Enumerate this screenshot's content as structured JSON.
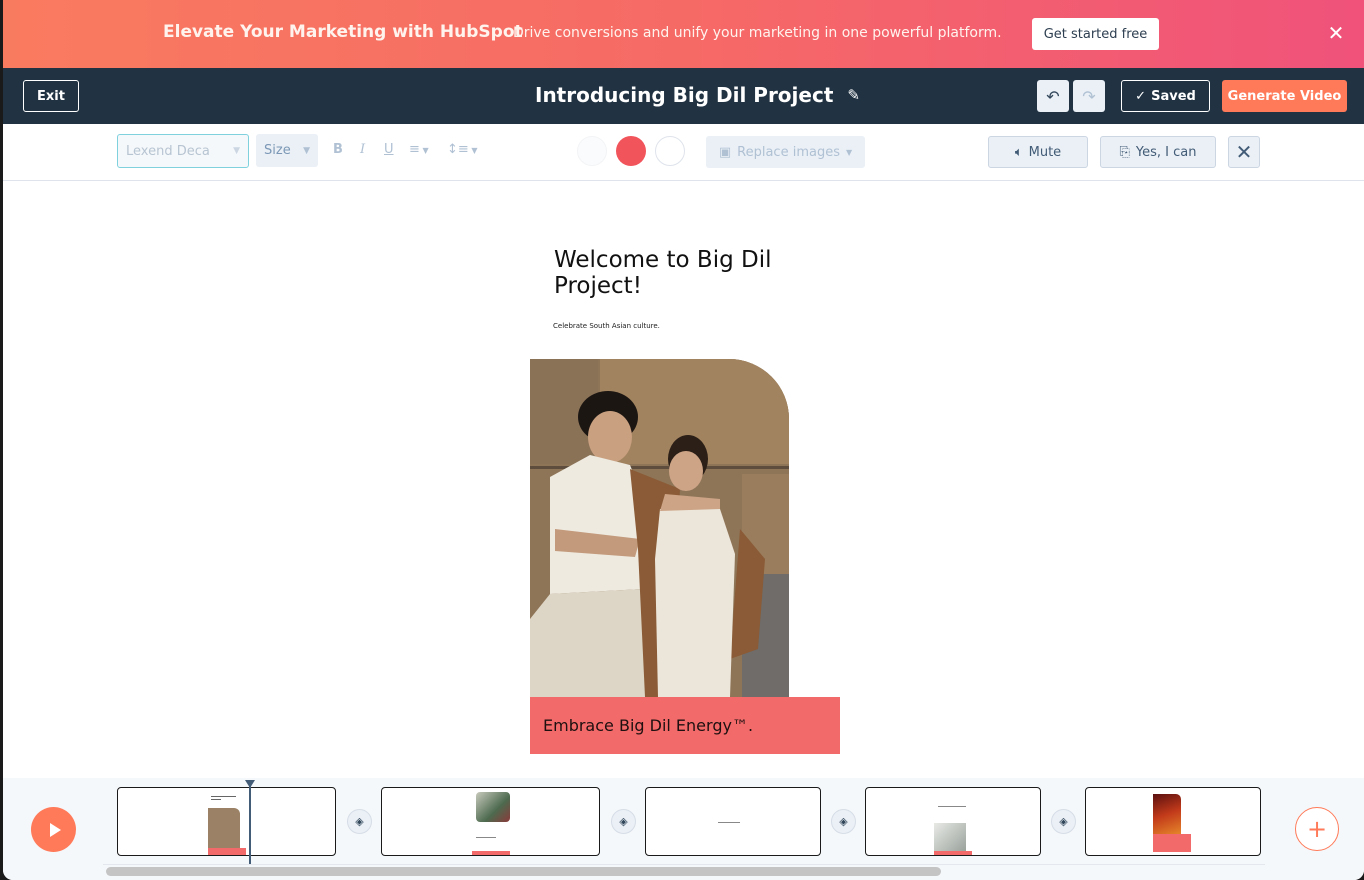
{
  "banner": {
    "title": "Elevate Your Marketing with HubSpot",
    "subtitle": "Drive conversions and unify your marketing in one powerful platform.",
    "cta_label": "Get started free",
    "close_icon": "close-icon"
  },
  "header": {
    "exit_label": "Exit",
    "title": "Introducing Big Dil Project",
    "edit_icon": "pencil-icon",
    "undo_icon": "undo-icon",
    "redo_icon": "redo-icon",
    "saved_label": "Saved",
    "generate_label": "Generate Video"
  },
  "toolbar": {
    "font_value": "Lexend Deca",
    "size_label": "Size",
    "bold": "B",
    "italic": "I",
    "underline": "U",
    "colors": [
      "#fafbfc",
      "#f2545b",
      "#ffffff"
    ],
    "replace_images_label": "Replace images",
    "mute_label": "Mute",
    "voice_label": "Yes, I can"
  },
  "slide": {
    "heading": "Welcome to Big Dil Project!",
    "subheading": "Celebrate South Asian culture.",
    "caption": "Embrace Big Dil Energy™.",
    "accent_color": "#f36a6a"
  },
  "timeline": {
    "play_icon": "play-icon",
    "add_icon": "plus-icon",
    "scenes": [
      {
        "name": "scene-1",
        "selected": true
      },
      {
        "name": "scene-2"
      },
      {
        "name": "scene-3"
      },
      {
        "name": "scene-4"
      },
      {
        "name": "scene-5"
      }
    ]
  }
}
